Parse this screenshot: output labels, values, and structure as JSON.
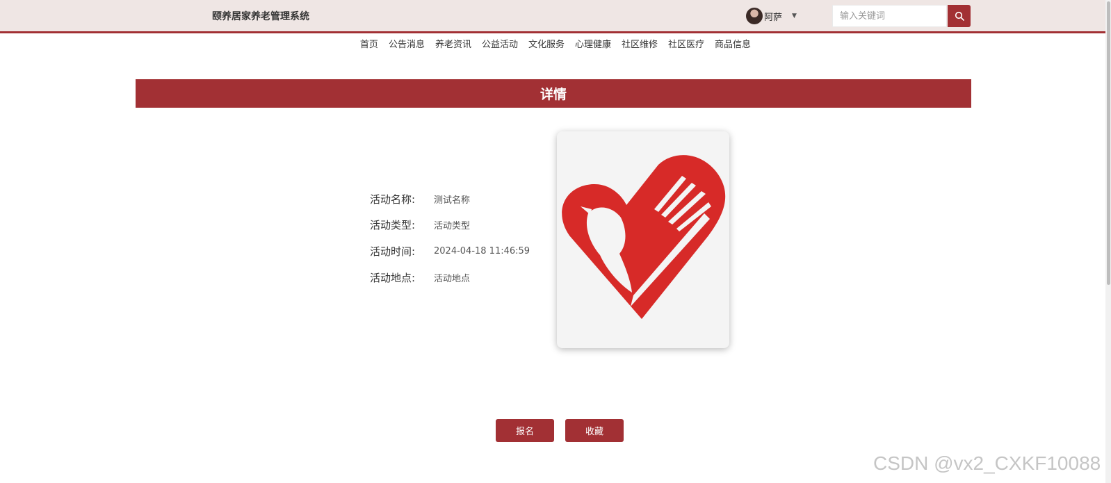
{
  "header": {
    "title": "颐养居家养老管理系统",
    "user_name": "阿萨",
    "search_placeholder": "输入关键词",
    "search_icon": "search-icon",
    "accent_color": "#a23034"
  },
  "nav": {
    "items": [
      "首页",
      "公告消息",
      "养老资讯",
      "公益活动",
      "文化服务",
      "心理健康",
      "社区维修",
      "社区医疗",
      "商品信息"
    ]
  },
  "detail": {
    "header": "详情",
    "fields": [
      {
        "label": "活动名称:",
        "value": "测试名称"
      },
      {
        "label": "活动类型:",
        "value": "活动类型"
      },
      {
        "label": "活动时间:",
        "value": "2024-04-18 11:46:59"
      },
      {
        "label": "活动地点:",
        "value": "活动地点"
      }
    ],
    "image_icon": "heart-dove-hand-logo"
  },
  "actions": {
    "signup_label": "报名",
    "favorite_label": "收藏"
  },
  "watermark": "CSDN @vx2_CXKF10088"
}
